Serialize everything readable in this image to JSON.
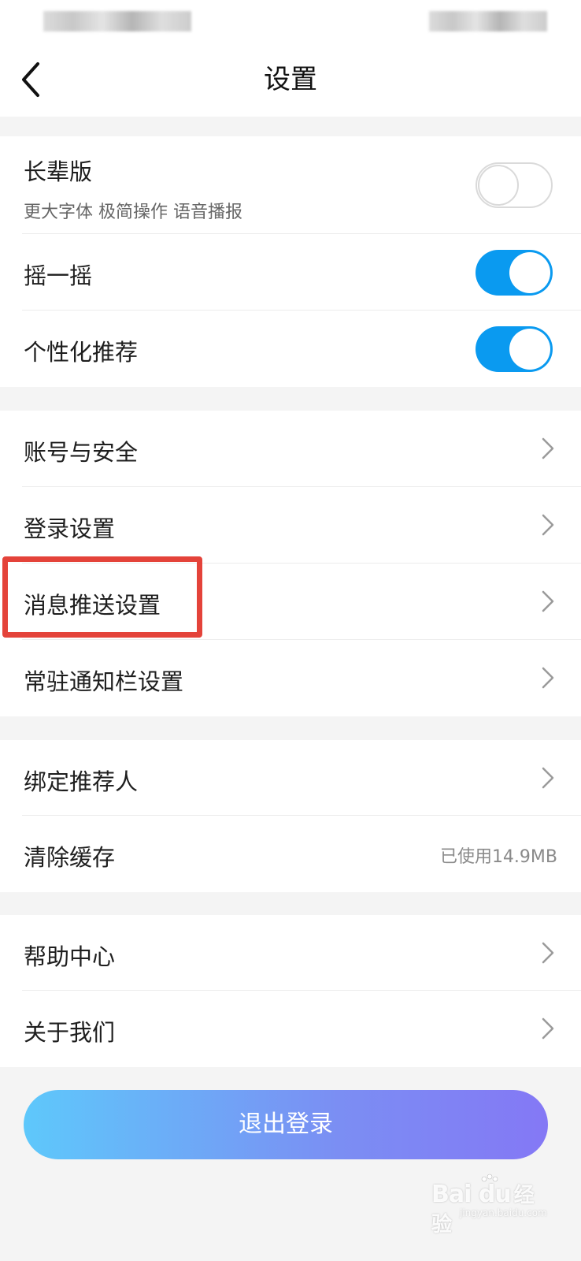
{
  "nav": {
    "title": "设置"
  },
  "group1": {
    "elder": {
      "label": "长辈版",
      "subtitle": "更大字体 极简操作 语音播报",
      "enabled": false
    },
    "shake": {
      "label": "摇一摇",
      "enabled": true
    },
    "personalized": {
      "label": "个性化推荐",
      "enabled": true
    }
  },
  "group2": {
    "items": [
      {
        "label": "账号与安全"
      },
      {
        "label": "登录设置"
      },
      {
        "label": "消息推送设置"
      },
      {
        "label": "常驻通知栏设置"
      }
    ]
  },
  "group3": {
    "bind_referrer": {
      "label": "绑定推荐人"
    },
    "clear_cache": {
      "label": "清除缓存",
      "value": "已使用14.9MB"
    }
  },
  "group4": {
    "items": [
      {
        "label": "帮助中心"
      },
      {
        "label": "关于我们"
      }
    ]
  },
  "logout": {
    "label": "退出登录"
  },
  "watermark": {
    "logo": "Bai du",
    "text": "经验",
    "url": "jingyan.baidu.com"
  },
  "colors": {
    "toggle_on": "#0a9af0",
    "highlight": "#e4433a",
    "logout_gradient_start": "#5ec8fb",
    "logout_gradient_end": "#8478f5"
  },
  "icons": {
    "back": "chevron-left-icon",
    "row_arrow": "chevron-right-icon"
  }
}
